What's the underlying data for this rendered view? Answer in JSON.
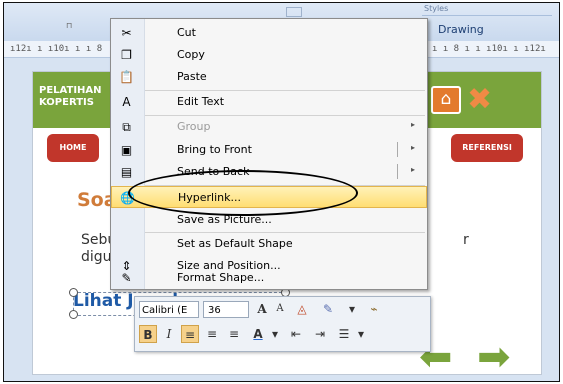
{
  "ribbon": {
    "launcher": "⊓",
    "styles_group": "Styles",
    "drawing_label": "Drawing"
  },
  "ruler": {
    "left": "ı12ı ı ı10ı ı ı 8",
    "right": "ı ı 8 ı ı ı10ı ı ı12ı"
  },
  "slide": {
    "title_line1": "PELATIHAN",
    "title_line2": "KOPERTIS",
    "home_button": "HOME",
    "referensi_button": "REFERENSI",
    "soal_title": "Soal",
    "question_line1": "Sebutk",
    "question_line2": "diguna",
    "question_tail": "r",
    "answer_link": "Lihat Jawaban"
  },
  "menu": {
    "items": [
      {
        "label": "Cut",
        "icon": "scissors-icon",
        "glyph": "✂"
      },
      {
        "label": "Copy",
        "icon": "copy-icon",
        "glyph": "❐"
      },
      {
        "label": "Paste",
        "icon": "paste-icon",
        "glyph": "📋"
      },
      {
        "label": "Edit Text",
        "icon": "edit-text-icon",
        "glyph": "A"
      },
      {
        "label": "Group",
        "icon": "group-icon",
        "glyph": "⧉"
      },
      {
        "label": "Bring to Front",
        "icon": "bring-to-front-icon",
        "glyph": "▣"
      },
      {
        "label": "Send to Back",
        "icon": "send-to-back-icon",
        "glyph": "▤"
      },
      {
        "label": "Hyperlink...",
        "icon": "hyperlink-icon",
        "glyph": "🌐"
      },
      {
        "label": "Save as Picture...",
        "icon": "",
        "glyph": ""
      },
      {
        "label": "Set as Default Shape",
        "icon": "",
        "glyph": ""
      },
      {
        "label": "Size and Position...",
        "icon": "size-position-icon",
        "glyph": "⇕"
      },
      {
        "label": "Format Shape...",
        "icon": "format-shape-icon",
        "glyph": "✎"
      }
    ],
    "submenu_arrow": "▸"
  },
  "mini_toolbar": {
    "font": "Calibri (E",
    "size": "36",
    "grow_font": "A",
    "shrink_font": "A",
    "bold": "B",
    "italic": "I",
    "align_left": "≡",
    "center": "≡",
    "align_right": "≡",
    "font_color": "A",
    "dec_indent": "⇤",
    "inc_indent": "⇥",
    "bullets": "☰",
    "dropdown": "▾"
  },
  "colors": {
    "accent_green": "#7aa43c",
    "nav_red": "#c1362b",
    "highlight": "#ffde73"
  }
}
